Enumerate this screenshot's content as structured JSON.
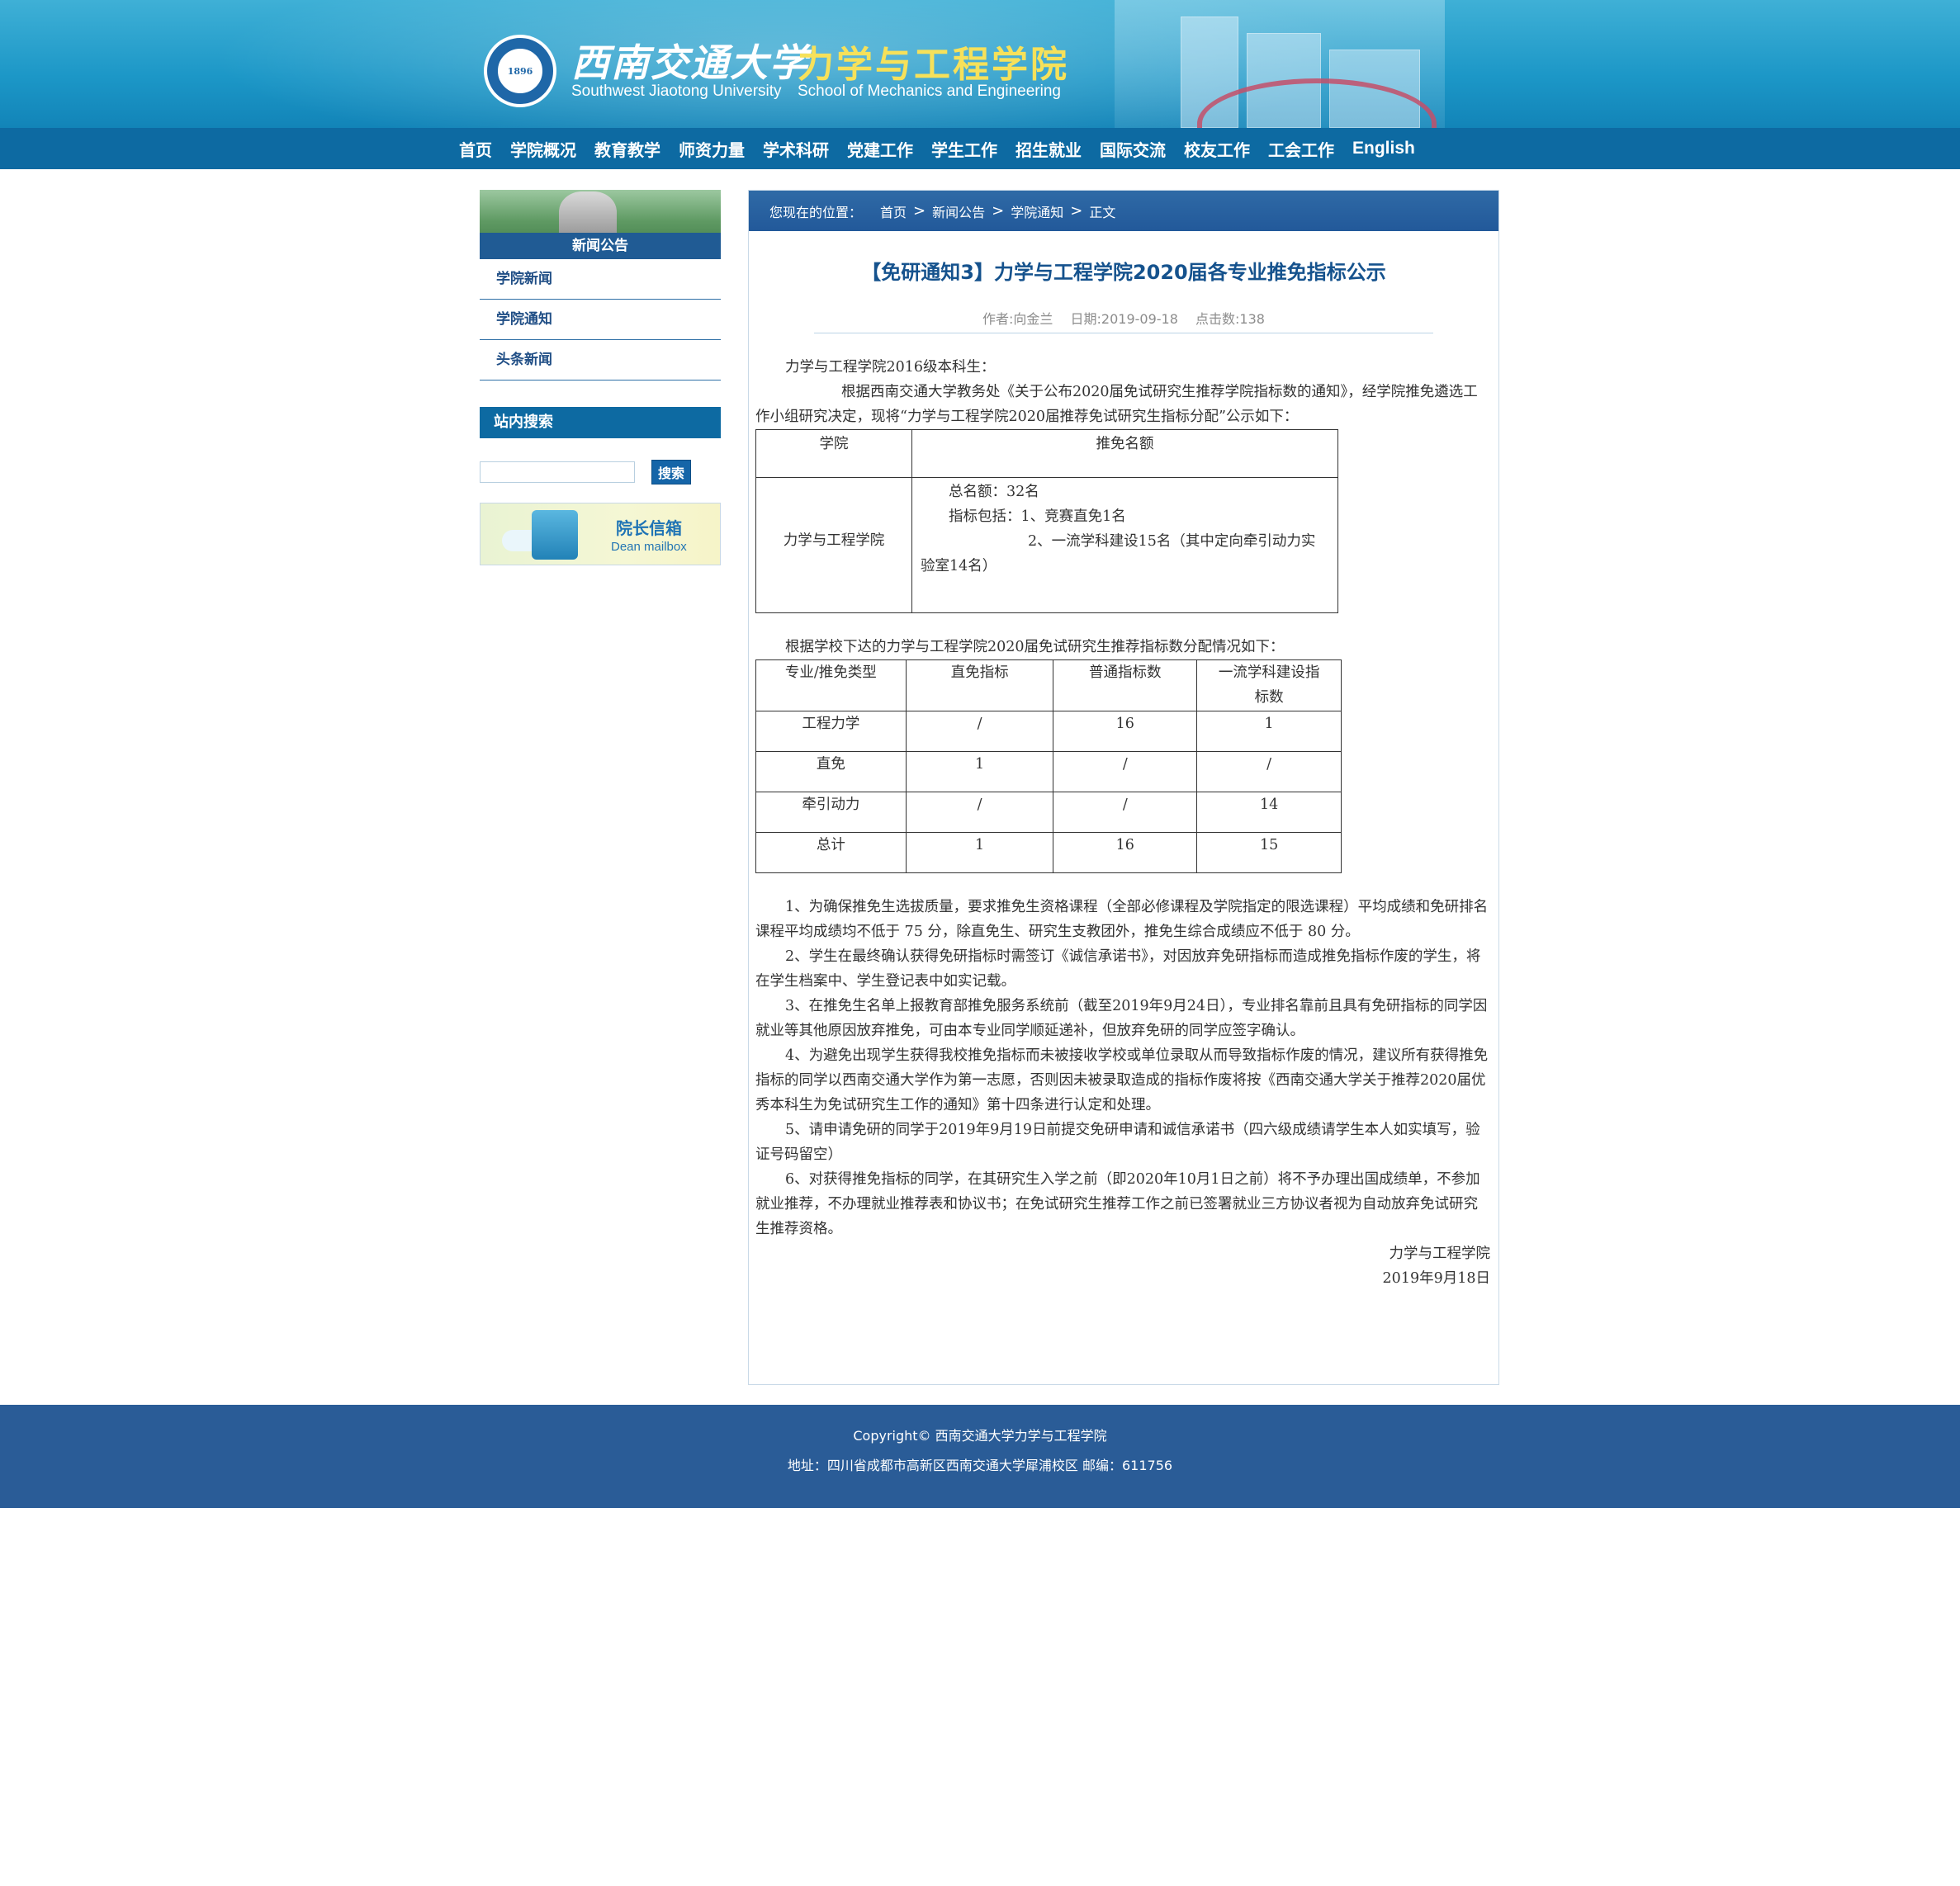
{
  "header": {
    "university_cn": "西南交通大学",
    "school_cn": "力学与工程学院",
    "university_en": "Southwest Jiaotong University",
    "school_en": "School of Mechanics and Engineering",
    "logo_year": "1896"
  },
  "nav": [
    "首页",
    "学院概况",
    "教育教学",
    "师资力量",
    "学术科研",
    "党建工作",
    "学生工作",
    "招生就业",
    "国际交流",
    "校友工作",
    "工会工作",
    "English"
  ],
  "sidebar": {
    "section_title": "新闻公告",
    "items": [
      "学院新闻",
      "学院通知",
      "头条新闻"
    ],
    "search_title": "站内搜索",
    "search_value": "",
    "search_button": "搜索",
    "mailbox_cn": "院长信箱",
    "mailbox_en": "Dean mailbox"
  },
  "breadcrumb": {
    "label": "您现在的位置：",
    "items": [
      "首页",
      "新闻公告",
      "学院通知",
      "正文"
    ],
    "separator": ">"
  },
  "article": {
    "title": "【免研通知3】力学与工程学院2020届各专业推免指标公示",
    "author": "作者:向金兰",
    "date": "日期:2019-09-18",
    "clicks": "点击数:138",
    "greeting": "力学与工程学院2016级本科生：",
    "intro": "根据西南交通大学教务处《关于公布2020届免试研究生推荐学院指标数的通知》，经学院推免遴选工作小组研究决定，现将“力学与工程学院2020届推荐免试研究生指标分配”公示如下：",
    "table1": {
      "headers": [
        "学院",
        "推免名额"
      ],
      "college": "力学与工程学院",
      "quota_lines": [
        "总名额：32名",
        "指标包括：1、竞赛直免1名",
        "2、一流学科建设15名（其中定向牵引动力实验室14名）"
      ]
    },
    "dist_intro": "根据学校下达的力学与工程学院2020届免试研究生推荐指标数分配情况如下：",
    "table2": {
      "headers": [
        "专业/推免类型",
        "直免指标",
        "普通指标数",
        "一流学科建设指标数"
      ],
      "rows": [
        [
          "工程力学",
          "/",
          "16",
          "1"
        ],
        [
          "直免",
          "1",
          "/",
          "/"
        ],
        [
          "牵引动力",
          "/",
          "/",
          "14"
        ],
        [
          "总计",
          "1",
          "16",
          "15"
        ]
      ]
    },
    "notes": [
      "1、为确保推免生选拔质量，要求推免生资格课程（全部必修课程及学院指定的限选课程）平均成绩和免研排名课程平均成绩均不低于 75 分，除直免生、研究生支教团外，推免生综合成绩应不低于 80 分。",
      "2、学生在最终确认获得免研指标时需签订《诚信承诺书》，对因放弃免研指标而造成推免指标作废的学生，将在学生档案中、学生登记表中如实记载。",
      "3、在推免生名单上报教育部推免服务系统前（截至2019年9月24日），专业排名靠前且具有免研指标的同学因就业等其他原因放弃推免，可由本专业同学顺延递补，但放弃免研的同学应签字确认。",
      "4、为避免出现学生获得我校推免指标而未被接收学校或单位录取从而导致指标作废的情况，建议所有获得推免指标的同学以西南交通大学作为第一志愿，否则因未被录取造成的指标作废将按《西南交通大学关于推荐2020届优秀本科生为免试研究生工作的通知》第十四条进行认定和处理。",
      "5、请申请免研的同学于2019年9月19日前提交免研申请和诚信承诺书（四六级成绩请学生本人如实填写，验证号码留空）",
      "6、对获得推免指标的同学，在其研究生入学之前（即2020年10月1日之前）将不予办理出国成绩单，不参加就业推荐，不办理就业推荐表和协议书；在免试研究生推荐工作之前已签署就业三方协议者视为自动放弃免试研究生推荐资格。"
    ],
    "signature_org": "力学与工程学院",
    "signature_date": "2019年9月18日"
  },
  "footer": {
    "copyright": "Copyright© 西南交通大学力学与工程学院",
    "address": "地址：四川省成都市高新区西南交通大学犀浦校区 邮编：611756"
  },
  "colors": {
    "nav_bg": "#0d6aa2",
    "title": "#15528d",
    "footer_bg": "#2a5c97"
  }
}
